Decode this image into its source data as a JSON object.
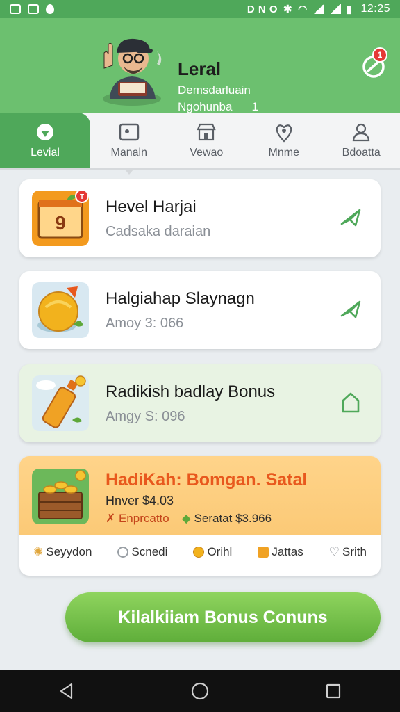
{
  "status_bar": {
    "left_icons": [
      "notification-square-icon",
      "image-square-icon",
      "drop-icon"
    ],
    "indicators": "D N O",
    "time": "12:25"
  },
  "header": {
    "title": "Leral",
    "subtitle_line1": "Demsdarluain",
    "subtitle_line2": "Ngohunba",
    "subtitle_count": "1",
    "badge_count": "1"
  },
  "tabs": [
    {
      "label": "Levial",
      "icon": "ticket-icon",
      "active": true
    },
    {
      "label": "Manaln",
      "icon": "picture-icon",
      "active": false
    },
    {
      "label": "Vewao",
      "icon": "store-icon",
      "active": false
    },
    {
      "label": "Mnme",
      "icon": "heart-pin-icon",
      "active": false
    },
    {
      "label": "Bdoatta",
      "icon": "person-icon",
      "active": false
    }
  ],
  "cards": [
    {
      "title": "Hevel Harjai",
      "subtitle": "Cadsaka daraian",
      "badge": "T"
    },
    {
      "title": "Halgiahap Slaynagn",
      "subtitle": "Amoy 3: 066"
    },
    {
      "title": "Radikish badlay Bonus",
      "subtitle": "Amgy S: 096"
    },
    {
      "title": "HadiKah: Bomgan. Satal",
      "line1": "Hnver $4.03",
      "line2_left": "Enprcatto",
      "line2_right": "Seratat $3.966"
    }
  ],
  "bottom_row": [
    {
      "label": "Seyydon",
      "icon": "leaf-icon"
    },
    {
      "label": "Scnedi",
      "icon": "circle-icon"
    },
    {
      "label": "Orihl",
      "icon": "coin-icon"
    },
    {
      "label": "Jattas",
      "icon": "box-icon"
    },
    {
      "label": "Srith",
      "icon": "heart-icon"
    }
  ],
  "cta_button": "Kilalkiiam Bonus Conuns",
  "colors": {
    "header_green": "#6cc06f",
    "accent_green": "#4fa85a",
    "orange_title": "#e8581d",
    "badge_red": "#e53935"
  }
}
